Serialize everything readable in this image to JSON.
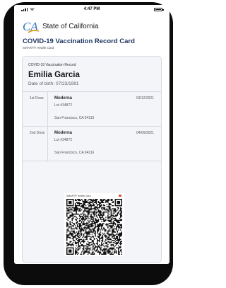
{
  "status_bar": {
    "time": "4:47 PM"
  },
  "header": {
    "state_name": "State of California",
    "logo_text": "CA"
  },
  "card": {
    "title": "COVID-19 Vaccination Record Card",
    "subtitle": "SMART® Health Card",
    "record_label": "COVID-19 Vaccination Record",
    "name": "Emilia Garcia",
    "dob": "Date of birth: 07/23/1991"
  },
  "doses": [
    {
      "label": "1st Dose",
      "manufacturer": "Moderna",
      "date": "03/12/2021",
      "lot": "Lot #34872",
      "location": "San Francisco, CA 94116"
    },
    {
      "label": "2nd Dose",
      "manufacturer": "Moderna",
      "date": "04/09/2021",
      "lot": "Lot #34872",
      "location": "San Francisco, CA 94116"
    }
  ],
  "qr": {
    "caption": "SMART® Health Card"
  },
  "colors": {
    "title": "#1f3560",
    "logo_blue": "#2f73c4",
    "logo_gold": "#e1a530",
    "phone_frame": "#0c0c0c"
  }
}
